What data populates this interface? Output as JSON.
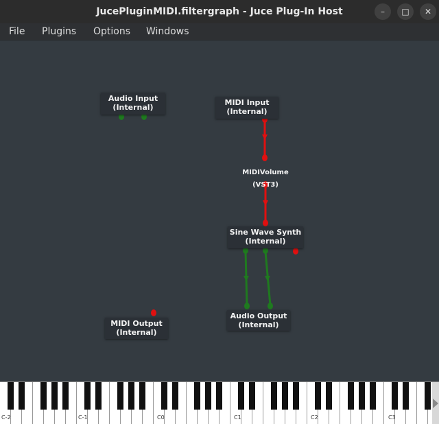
{
  "window": {
    "title": "JucePluginMIDI.filtergraph - Juce Plug-In Host",
    "minimize_glyph": "–",
    "maximize_glyph": "□",
    "close_glyph": "✕"
  },
  "menu": {
    "file": "File",
    "plugins": "Plugins",
    "options": "Options",
    "windows": "Windows"
  },
  "nodes": {
    "audio_input": {
      "name": "Audio Input",
      "sub": "(Internal)"
    },
    "midi_input": {
      "name": "MIDI Input",
      "sub": "(Internal)"
    },
    "midi_volume": {
      "name": "MIDIVolume (VST3)"
    },
    "sine_synth": {
      "name": "Sine Wave Synth",
      "sub": "(Internal)"
    },
    "audio_output": {
      "name": "Audio Output",
      "sub": "(Internal)"
    },
    "midi_output": {
      "name": "MIDI Output",
      "sub": "(Internal)"
    }
  },
  "colors": {
    "audio_pin": "#1f7a1f",
    "midi_pin": "#e01010",
    "canvas_bg": "#343b41",
    "node_bg": "#2b3036"
  },
  "keyboard": {
    "octave_labels": [
      "C-2",
      "C-1",
      "C0",
      "C1",
      "C2",
      "C3"
    ]
  }
}
